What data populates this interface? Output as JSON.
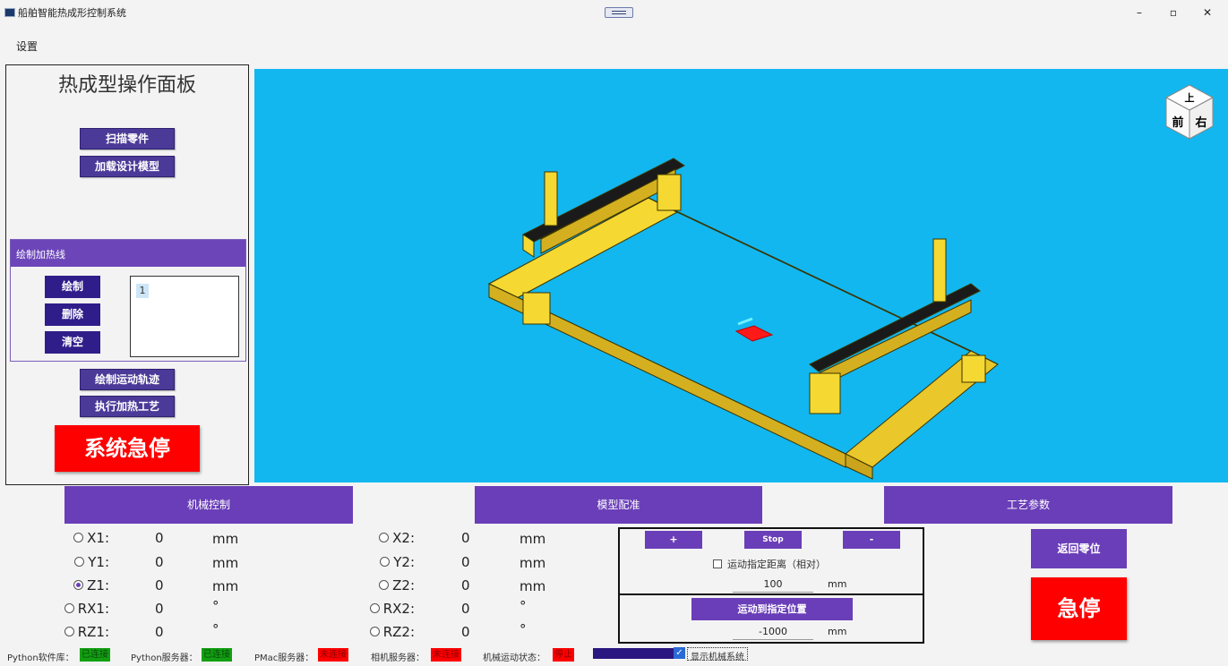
{
  "window": {
    "title": "船舶智能热成形控制系统",
    "minimize": "–",
    "restore": "▫",
    "close": "✕"
  },
  "menu": {
    "settings": "设置"
  },
  "left_panel": {
    "title": "热成型操作面板",
    "scan_parts": "扫描零件",
    "load_design_model": "加载设计模型",
    "heat_line_group": {
      "header": "绘制加热线",
      "draw": "绘制",
      "delete": "删除",
      "clear": "清空",
      "list_items": [
        "1"
      ]
    },
    "draw_motion_path": "绘制运动轨迹",
    "execute_heating": "执行加热工艺",
    "system_estop": "系统急停"
  },
  "viewcube": {
    "top": "上",
    "front": "前",
    "right": "右"
  },
  "tabs": [
    "机械控制",
    "模型配准",
    "工艺参数"
  ],
  "axes_left": [
    {
      "label": "X1:",
      "value": "0",
      "unit": "mm",
      "selected": false
    },
    {
      "label": "Y1:",
      "value": "0",
      "unit": "mm",
      "selected": false
    },
    {
      "label": "Z1:",
      "value": "0",
      "unit": "mm",
      "selected": true
    },
    {
      "label": "RX1:",
      "value": "0",
      "unit": "°",
      "selected": false
    },
    {
      "label": "RZ1:",
      "value": "0",
      "unit": "°",
      "selected": false
    }
  ],
  "axes_right": [
    {
      "label": "X2:",
      "value": "0",
      "unit": "mm",
      "selected": false
    },
    {
      "label": "Y2:",
      "value": "0",
      "unit": "mm",
      "selected": false
    },
    {
      "label": "Z2:",
      "value": "0",
      "unit": "mm",
      "selected": false
    },
    {
      "label": "RX2:",
      "value": "0",
      "unit": "°",
      "selected": false
    },
    {
      "label": "RZ2:",
      "value": "0",
      "unit": "°",
      "selected": false
    }
  ],
  "motion": {
    "plus": "+",
    "stop": "Stop",
    "minus": "-",
    "relative_label": "运动指定距离（相对）",
    "relative_checked": false,
    "distance_value": "100",
    "distance_unit": "mm",
    "move_to_position": "运动到指定位置",
    "position_value": "-1000",
    "position_unit": "mm"
  },
  "return_zero": "返回零位",
  "estop": "急停",
  "status": {
    "python_lib_label": "Python软件库：",
    "python_lib_value": "已连接",
    "python_server_label": "Python服务器：",
    "python_server_value": "已连接",
    "pmac_label": "PMac服务器：",
    "pmac_value": "未连接",
    "camera_label": "相机服务器：",
    "camera_value": "未连接",
    "motion_label": "机械运动状态：",
    "motion_value": "停止",
    "show_machine_label": "显示机械系统",
    "show_machine_checked": true
  },
  "colors": {
    "accent": "#6a3eb8",
    "viewport_bg": "#12b7ef",
    "estop": "#ff0000",
    "connected": "#12a012",
    "disconnected": "#ff0000",
    "machine_yellow": "#f5d832"
  }
}
